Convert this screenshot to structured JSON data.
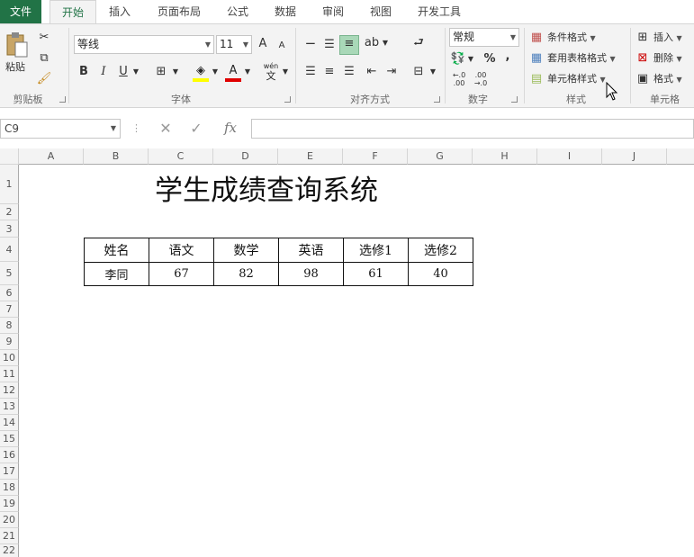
{
  "tabs": [
    "文件",
    "开始",
    "插入",
    "页面布局",
    "公式",
    "数据",
    "审阅",
    "视图",
    "开发工具"
  ],
  "ribbon": {
    "clipboard": {
      "paste": "粘贴",
      "label": "剪贴板"
    },
    "font": {
      "name": "等线",
      "size": "11",
      "label": "字体",
      "bold": "B",
      "italic": "I",
      "underline": "U",
      "grow": "A",
      "shrink": "A",
      "phonetic_top": "wén",
      "phonetic_bottom": "文"
    },
    "align": {
      "label": "对齐方式"
    },
    "number": {
      "format": "常规",
      "percent": "%",
      "comma": ",",
      "inc": "←.0\n.00",
      "dec": ".00\n→.0",
      "label": "数字"
    },
    "styles": {
      "conditional": "条件格式",
      "table": "套用表格格式",
      "cell": "单元格样式",
      "label": "样式"
    },
    "cells": {
      "insert": "插入",
      "delete": "删除",
      "format": "格式",
      "label": "单元格"
    }
  },
  "formula_bar": {
    "name_box": "C9",
    "fx": "fx",
    "value": ""
  },
  "columns": [
    "A",
    "B",
    "C",
    "D",
    "E",
    "F",
    "G",
    "H",
    "I",
    "J"
  ],
  "rows": [
    "1",
    "2",
    "3",
    "4",
    "5",
    "6",
    "7",
    "8",
    "9",
    "10",
    "11",
    "12",
    "13",
    "14",
    "15",
    "16",
    "17",
    "18",
    "19",
    "20",
    "21",
    "22"
  ],
  "sheet": {
    "title": "学生成绩查询系统",
    "headers": [
      "姓名",
      "语文",
      "数学",
      "英语",
      "选修1",
      "选修2"
    ],
    "record": [
      "李同",
      "67",
      "82",
      "98",
      "61",
      "40"
    ]
  },
  "colors": {
    "accent": "#217346",
    "border": "#d5d5d5",
    "header_bg": "#f3f3f3"
  }
}
